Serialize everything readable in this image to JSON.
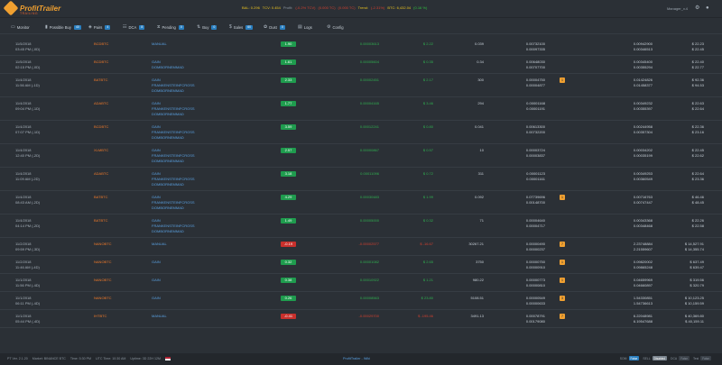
{
  "header": {
    "logo_text": "ProfitTrailer",
    "logo_sub": "TRAILING",
    "stats": [
      {
        "text": "BAL: 0.296",
        "color": "yellow"
      },
      {
        "text": "TCV: 0.454",
        "color": "yellow"
      },
      {
        "text": "Profit:",
        "color": "grey"
      },
      {
        "text": "(-0.2% TCV)",
        "color": "red"
      },
      {
        "text": "(0.000 TC)",
        "color": "red"
      },
      {
        "text": "(0.000 TC)",
        "color": "red"
      },
      {
        "text": "Trend:",
        "color": "yellow"
      },
      {
        "text": "(-2.31%)",
        "color": "red"
      },
      {
        "text": "BTC: 6,432.04",
        "color": "yellow"
      },
      {
        "text": "(0.16 %)",
        "color": "green"
      }
    ],
    "user": "Manager_v.4"
  },
  "menu": [
    {
      "label": "Monitor",
      "icon": "monitor-icon",
      "glyph": "▭",
      "badge": ""
    },
    {
      "label": "Possible Buy",
      "icon": "chart-icon",
      "glyph": "▮",
      "badge": "40"
    },
    {
      "label": "Pairs",
      "icon": "pairs-icon",
      "glyph": "◈",
      "badge": "4"
    },
    {
      "label": "DCA",
      "icon": "dca-icon",
      "glyph": "☷",
      "badge": "8"
    },
    {
      "label": "Pending",
      "icon": "pending-icon",
      "glyph": "⧖",
      "badge": "0"
    },
    {
      "label": "Buy",
      "icon": "buy-icon",
      "glyph": "⇅",
      "badge": "0"
    },
    {
      "label": "Sales",
      "icon": "sales-icon",
      "glyph": "$",
      "badge": "60"
    },
    {
      "label": "Dust",
      "icon": "dust-icon",
      "glyph": "✿",
      "badge": "0"
    },
    {
      "label": "Logs",
      "icon": "logs-icon",
      "glyph": "▤",
      "badge": ""
    },
    {
      "label": "Config",
      "icon": "config-icon",
      "glyph": "⚙",
      "badge": ""
    }
  ],
  "rows": [
    {
      "date": "11/5/2018",
      "time": "03:45 PM (-0D)",
      "market": "BCDBTC",
      "strategy": [
        "MANUAL"
      ],
      "pct": "1.90",
      "pct_neg": false,
      "bid": "0.00003613",
      "profit": "$ 2.22",
      "profit_neg": false,
      "amount": "0.039",
      "pair": [
        "0.00732100",
        "0.00097335"
      ],
      "warn": "",
      "cur": [
        "0.00942900",
        "0.00346513"
      ],
      "usd": [
        "$ 22.23",
        "$ 22.45"
      ]
    },
    {
      "date": "11/5/2018",
      "time": "02:15 PM (-0D)",
      "market": "BCDBTC",
      "strategy": [
        "GAIN",
        "DOMBORNEMMAD"
      ],
      "pct": "1.61",
      "pct_neg": false,
      "bid": "0.00005604",
      "profit": "$ 0.35",
      "profit_neg": false,
      "amount": "0.34",
      "pair": [
        "0.00648030",
        "0.00707700"
      ],
      "warn": "",
      "cur": [
        "0.00345400",
        "0.00355294"
      ],
      "usd": [
        "$ 22.40",
        "$ 22.77"
      ]
    },
    {
      "date": "11/4/2018",
      "time": "11:56 AM (-1D)",
      "market": "BATBTC",
      "strategy": [
        "GAIN",
        "FRANKENSTEINFCROSS",
        "DOMBORNEMMAD"
      ],
      "pct": "2.33",
      "pct_neg": false,
      "bid": "0.00002451",
      "profit": "$ 2.17",
      "profit_neg": false,
      "amount": "300",
      "pair": [
        "0.00004750",
        "0.00004877"
      ],
      "warn": "1",
      "cur": [
        "0.01424826",
        "0.01458377"
      ],
      "usd": [
        "$ 92.36",
        "$ 94.53"
      ]
    },
    {
      "date": "11/4/2018",
      "time": "09:04 PM (-1D)",
      "market": "ADABTC",
      "strategy": [
        "GAIN",
        "FRANKENSTEINFCROSS",
        "DOMBORNEMMAD"
      ],
      "pct": "1.77",
      "pct_neg": false,
      "bid": "0.00004165",
      "profit": "$ 3.46",
      "profit_neg": false,
      "amount": "294",
      "pair": [
        "0.00001168",
        "0.00001191"
      ],
      "warn": "",
      "cur": [
        "0.00349232",
        "0.00355397"
      ],
      "usd": [
        "$ 22.63",
        "$ 22.64"
      ]
    },
    {
      "date": "11/4/2018",
      "time": "07:07 PM (-1D)",
      "market": "BCDBTC",
      "strategy": [
        "GAIN",
        "FRANKENSTEINFCROSS",
        "DOMBORNEMMAD"
      ],
      "pct": "3.59",
      "pct_neg": false,
      "bid": "0.00012241",
      "profit": "$ 0.80",
      "profit_neg": false,
      "amount": "0.041",
      "pair": [
        "0.00613300",
        "0.00732200"
      ],
      "warn": "",
      "cur": [
        "0.00244958",
        "0.00357304"
      ],
      "usd": [
        "$ 22.36",
        "$ 23.16"
      ]
    },
    {
      "date": "11/4/2018",
      "time": "12:40 PM (-2D)",
      "market": "XLMBTC",
      "strategy": [
        "GAIN",
        "FRANKENSTEINFCROSS",
        "DOMBORNEMMAD"
      ],
      "pct": "2.57",
      "pct_neg": false,
      "bid": "0.00000867",
      "profit": "$ 0.57",
      "profit_neg": false,
      "amount": "10",
      "pair": [
        "0.00003724",
        "0.00003837"
      ],
      "warn": "",
      "cur": [
        "0.00034202",
        "0.00035199"
      ],
      "usd": [
        "$ 22.45",
        "$ 22.62"
      ]
    },
    {
      "date": "11/4/2018",
      "time": "11:09 AM (-2D)",
      "market": "ADABTC",
      "strategy": [
        "GAIN",
        "FRANKENSTEINFCROSS",
        "DOMBORNEMMAD"
      ],
      "pct": "3.18",
      "pct_neg": false,
      "bid": "0.00011096",
      "profit": "$ 0.72",
      "profit_neg": false,
      "amount": "311",
      "pair": [
        "0.00001123",
        "0.00001161"
      ],
      "warn": "",
      "cur": [
        "0.00349253",
        "0.00360549"
      ],
      "usd": [
        "$ 22.64",
        "$ 23.36"
      ]
    },
    {
      "date": "11/4/2018",
      "time": "08:43 AM (-2D)",
      "market": "BATBTC",
      "strategy": [
        "GAIN",
        "FRANKENSTEINFCROSS",
        "DOMBORNEMMAD"
      ],
      "pct": "4.29",
      "pct_neg": false,
      "bid": "0.00030483",
      "profit": "$ 1.99",
      "profit_neg": false,
      "amount": "0.092",
      "pair": [
        "0.07739696",
        "0.00148700"
      ],
      "warn": "1",
      "cur": [
        "0.00716763",
        "0.00747447"
      ],
      "usd": [
        "$ 46.46",
        "$ 48.45"
      ]
    },
    {
      "date": "11/4/2018",
      "time": "04:14 PM (-2D)",
      "market": "BATBTC",
      "strategy": [
        "GAIN",
        "FRANKENSTEINFCROSS",
        "DOMBORNEMMAD"
      ],
      "pct": "1.49",
      "pct_neg": false,
      "bid": "0.00005000",
      "profit": "$ 0.32",
      "profit_neg": false,
      "amount": "71",
      "pair": [
        "0.00004640",
        "0.00004717"
      ],
      "warn": "",
      "cur": [
        "0.00343368",
        "0.00348468"
      ],
      "usd": [
        "$ 22.26",
        "$ 22.58"
      ]
    },
    {
      "date": "11/2/2018",
      "time": "09:59 PM (-3D)",
      "market": "NANOBTC",
      "strategy": [
        "MANUAL"
      ],
      "pct": "-0.19",
      "pct_neg": true,
      "bid": "-0.00002577",
      "profit": "$ -16.67",
      "profit_neg": true,
      "amount": "30267.21",
      "pair": [
        "0.00000490",
        "0.00000237"
      ],
      "warn": "7",
      "cur": [
        "2.23748884",
        "2.21559607"
      ],
      "usd": [
        "$ 14,527.91",
        "$ 14,355.74"
      ]
    },
    {
      "date": "11/2/2018",
      "time": "11:46 AM (-4D)",
      "market": "NANOBTC",
      "strategy": [
        "GAIN"
      ],
      "pct": "0.32",
      "pct_neg": false,
      "bid": "0.00001082",
      "profit": "$ 2.65",
      "profit_neg": false,
      "amount": "3750",
      "pair": [
        "0.00000750",
        "0.00000910"
      ],
      "warn": "1",
      "cur": [
        "0.09820002",
        "0.09865248"
      ],
      "usd": [
        "$ 637.49",
        "$ 639.47"
      ]
    },
    {
      "date": "11/1/2018",
      "time": "11:56 PM (-4D)",
      "market": "NANOBTC",
      "strategy": [
        "GAIN"
      ],
      "pct": "0.38",
      "pct_neg": false,
      "bid": "0.00010922",
      "profit": "$ 1.21",
      "profit_neg": false,
      "amount": "980.22",
      "pair": [
        "0.00000773",
        "0.00000810"
      ],
      "warn": "1",
      "cur": [
        "0.04659969",
        "0.04660897"
      ],
      "usd": [
        "$ 319.56",
        "$ 320.79"
      ]
    },
    {
      "date": "11/1/2018",
      "time": "06:11 PM (-4D)",
      "market": "NANOBTC",
      "strategy": [
        "GAIN"
      ],
      "pct": "0.26",
      "pct_neg": false,
      "bid": "0.00008563",
      "profit": "$ 23.80",
      "profit_neg": false,
      "amount": "5108.51",
      "pair": [
        "0.00000549",
        "0.00000633"
      ],
      "warn": "3",
      "cur": [
        "1.54330851",
        "1.54736613"
      ],
      "usd": [
        "$ 10,123.25",
        "$ 10,159.59"
      ]
    },
    {
      "date": "11/1/2018",
      "time": "05:44 PM (-4D)",
      "market": "IHTBTC",
      "strategy": [
        "MANUAL"
      ],
      "pct": "-0.41",
      "pct_neg": true,
      "bid": "-0.00029700",
      "profit": "$ -195.46",
      "profit_neg": true,
      "amount": "3491.13",
      "pair": [
        "0.00078791",
        "0.00179080"
      ],
      "warn": "7",
      "cur": [
        "6.22048981",
        "6.19547688"
      ],
      "usd": [
        "$ 40,369.80",
        "$ 40,159.11"
      ]
    }
  ],
  "footer": {
    "version": "PT Ver. 2.1.20",
    "market": "Market: BINANCE BTC",
    "time": "Time: 5:30 PM",
    "utc": "UTC Time: 10:30 AM",
    "uptime": "Uptime: 3D 22H 12M",
    "center": "ProfitTrailer - Wiki",
    "toggles": [
      {
        "label": "SOM",
        "state": "False",
        "style": "on"
      },
      {
        "label": "SELL",
        "state": "Disabled",
        "style": "grey"
      },
      {
        "label": "DCA",
        "state": "False",
        "style": "off"
      },
      {
        "label": "Test",
        "state": "False",
        "style": "off"
      }
    ]
  }
}
